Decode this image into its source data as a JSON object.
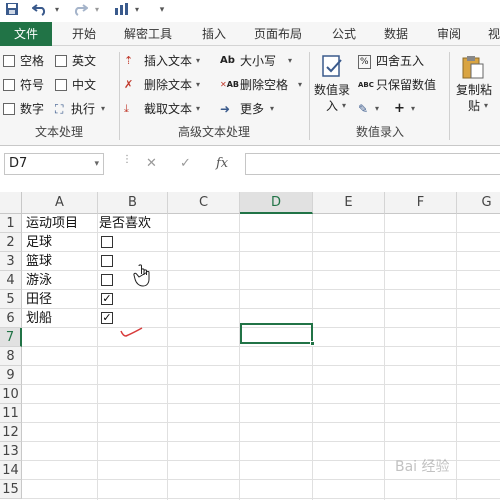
{
  "qat": {
    "save_icon": "save-icon",
    "undo_icon": "undo-icon",
    "redo_icon": "redo-icon",
    "chart_icon": "chart-icon",
    "customize_icon": "customize-icon"
  },
  "tabs": [
    "文件",
    "开始",
    "解密工具",
    "插入",
    "页面布局",
    "公式",
    "数据",
    "审阅",
    "视"
  ],
  "ribbon": {
    "text_processing": {
      "items": [
        "空格",
        "英文",
        "符号",
        "中文",
        "数字",
        "执行"
      ],
      "title": "文本处理"
    },
    "advanced_text": {
      "items": [
        "插入文本",
        "删除文本",
        "截取文本",
        "大小写",
        "删除空格",
        "更多"
      ],
      "title": "高级文本处理"
    },
    "value_entry": {
      "big_button": [
        "数值录",
        "入"
      ],
      "items": [
        "四舍五入",
        "只保留数值"
      ],
      "abc_prefix": "ABC",
      "title": "数值录入"
    },
    "paste": {
      "label": [
        "复制粘",
        "贴"
      ]
    }
  },
  "formula_bar": {
    "name_box": "D7",
    "fx": "fx"
  },
  "sheet": {
    "columns": [
      "A",
      "B",
      "C",
      "D",
      "E",
      "F",
      "G"
    ],
    "active_column": "D",
    "rows": [
      "1",
      "2",
      "3",
      "4",
      "5",
      "6",
      "7",
      "8",
      "9",
      "10",
      "11",
      "12",
      "13",
      "14",
      "15"
    ],
    "active_row": "7",
    "a_cells": [
      "运动项目",
      "足球",
      "篮球",
      "游泳",
      "田径",
      "划船"
    ],
    "b1": "是否喜欢",
    "checkboxes": [
      false,
      false,
      false,
      true,
      true
    ],
    "check_glyph": "✓"
  },
  "watermark": "Bai 经验"
}
